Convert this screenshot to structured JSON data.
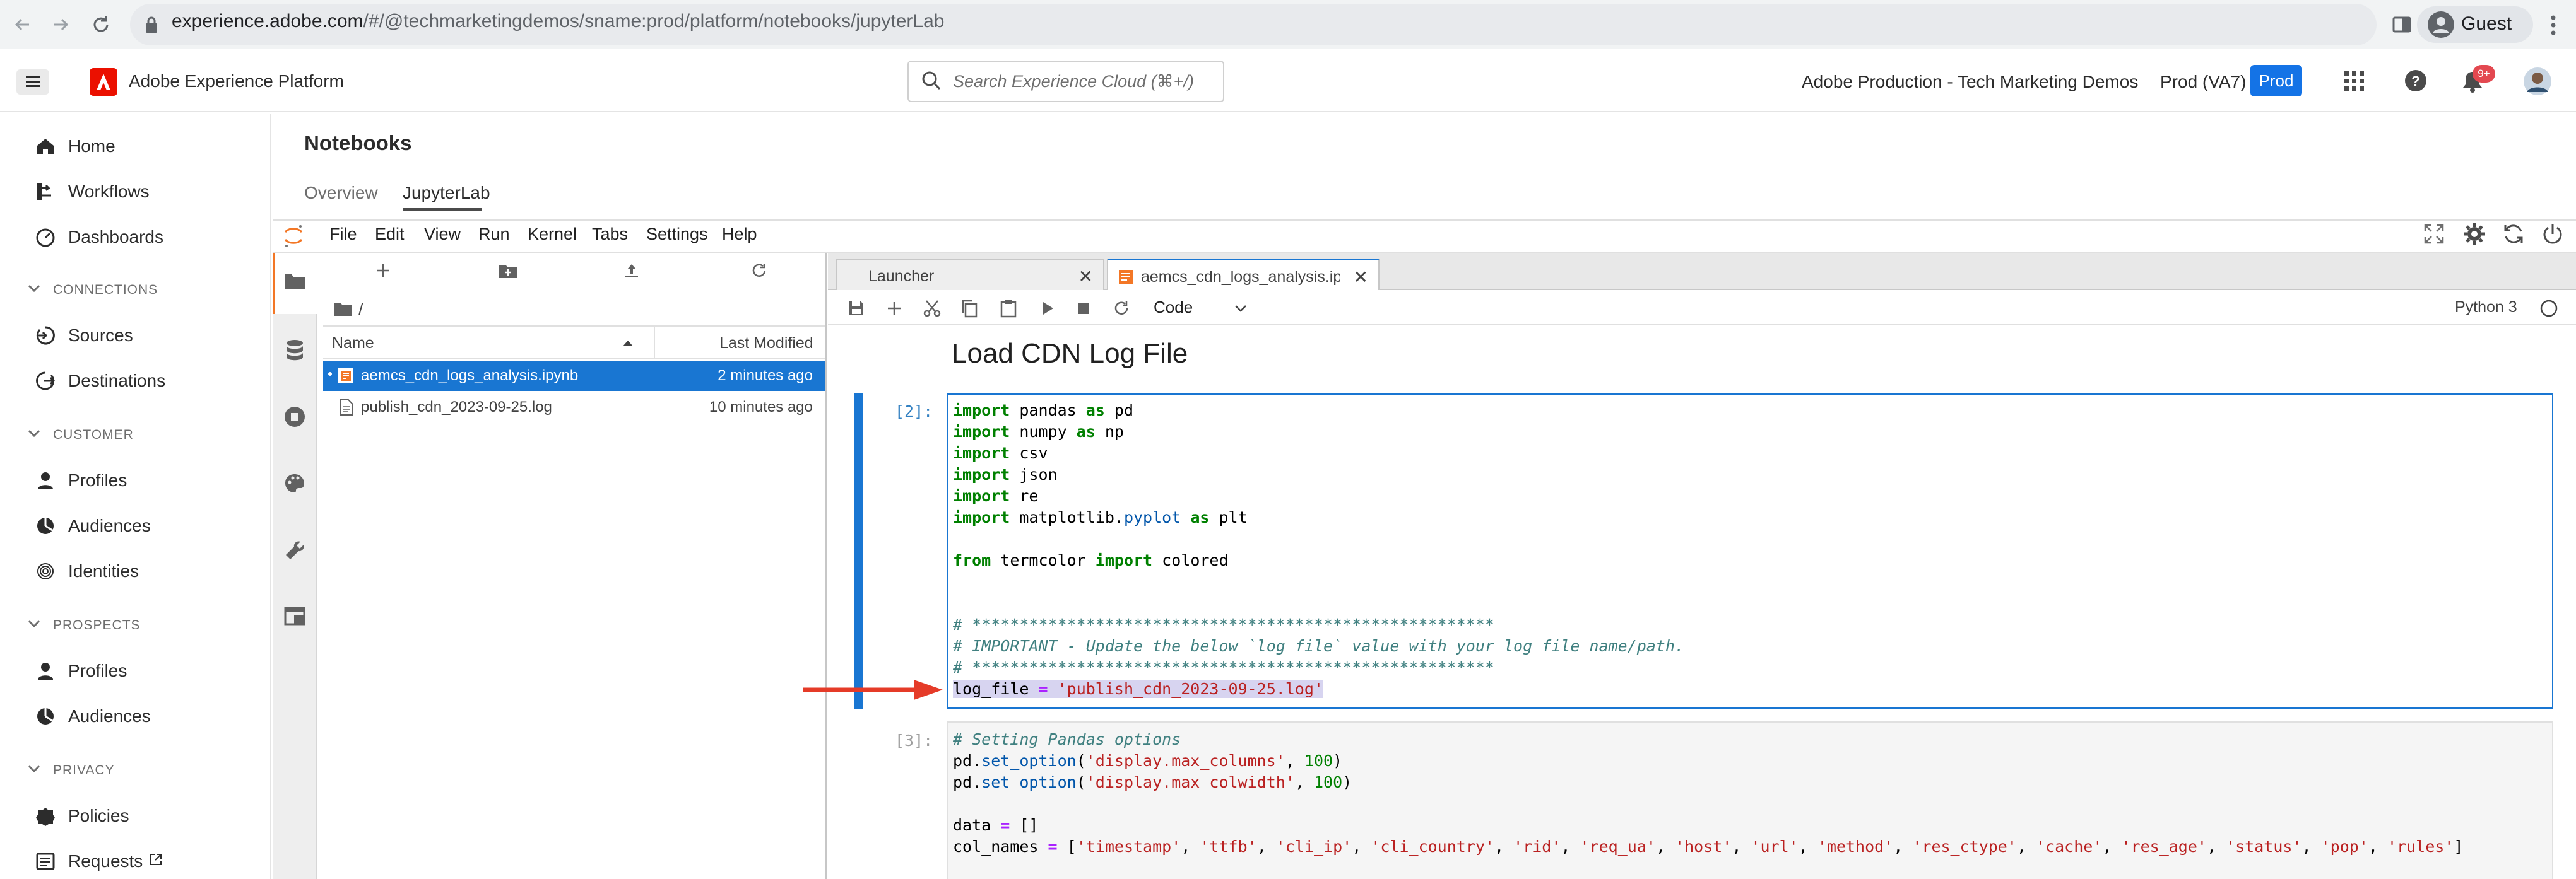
{
  "browser": {
    "url_host": "experience.adobe.com",
    "url_path": "/#/@techmarketingdemos/sname:prod/platform/notebooks/jupyterLab",
    "profile_label": "Guest"
  },
  "app_header": {
    "app_name": "Adobe Experience Platform",
    "search_placeholder": "Search Experience Cloud (⌘+/)",
    "org_name": "Adobe Production - Tech Marketing Demos",
    "sandbox_name": "Prod (VA7)",
    "sandbox_badge": "Prod",
    "notification_count": "9+"
  },
  "left_nav": {
    "home": "Home",
    "workflows": "Workflows",
    "dashboards": "Dashboards",
    "connections_section": "CONNECTIONS",
    "sources": "Sources",
    "destinations": "Destinations",
    "customer_section": "CUSTOMER",
    "customer_profiles": "Profiles",
    "customer_audiences": "Audiences",
    "identities": "Identities",
    "prospects_section": "PROSPECTS",
    "prospect_profiles": "Profiles",
    "prospect_audiences": "Audiences",
    "privacy_section": "PRIVACY",
    "policies": "Policies",
    "requests": "Requests"
  },
  "page": {
    "title": "Notebooks",
    "tabs": [
      "Overview",
      "JupyterLab"
    ]
  },
  "jupyter_menu": [
    "File",
    "Edit",
    "View",
    "Run",
    "Kernel",
    "Tabs",
    "Settings",
    "Help"
  ],
  "file_browser": {
    "path": "/",
    "col_name": "Name",
    "col_modified": "Last Modified",
    "files": [
      {
        "name": "aemcs_cdn_logs_analysis.ipynb",
        "modified": "2 minutes ago"
      },
      {
        "name": "publish_cdn_2023-09-25.log",
        "modified": "10 minutes ago"
      }
    ]
  },
  "doc_tabs": [
    "Launcher",
    "aemcs_cdn_logs_analysis.ipyn"
  ],
  "notebook_toolbar": {
    "cell_type": "Code",
    "kernel": "Python 3"
  },
  "notebook": {
    "heading": "Load CDN Log File",
    "cell2_prompt": "[2]:",
    "cell3_prompt": "[3]:"
  }
}
